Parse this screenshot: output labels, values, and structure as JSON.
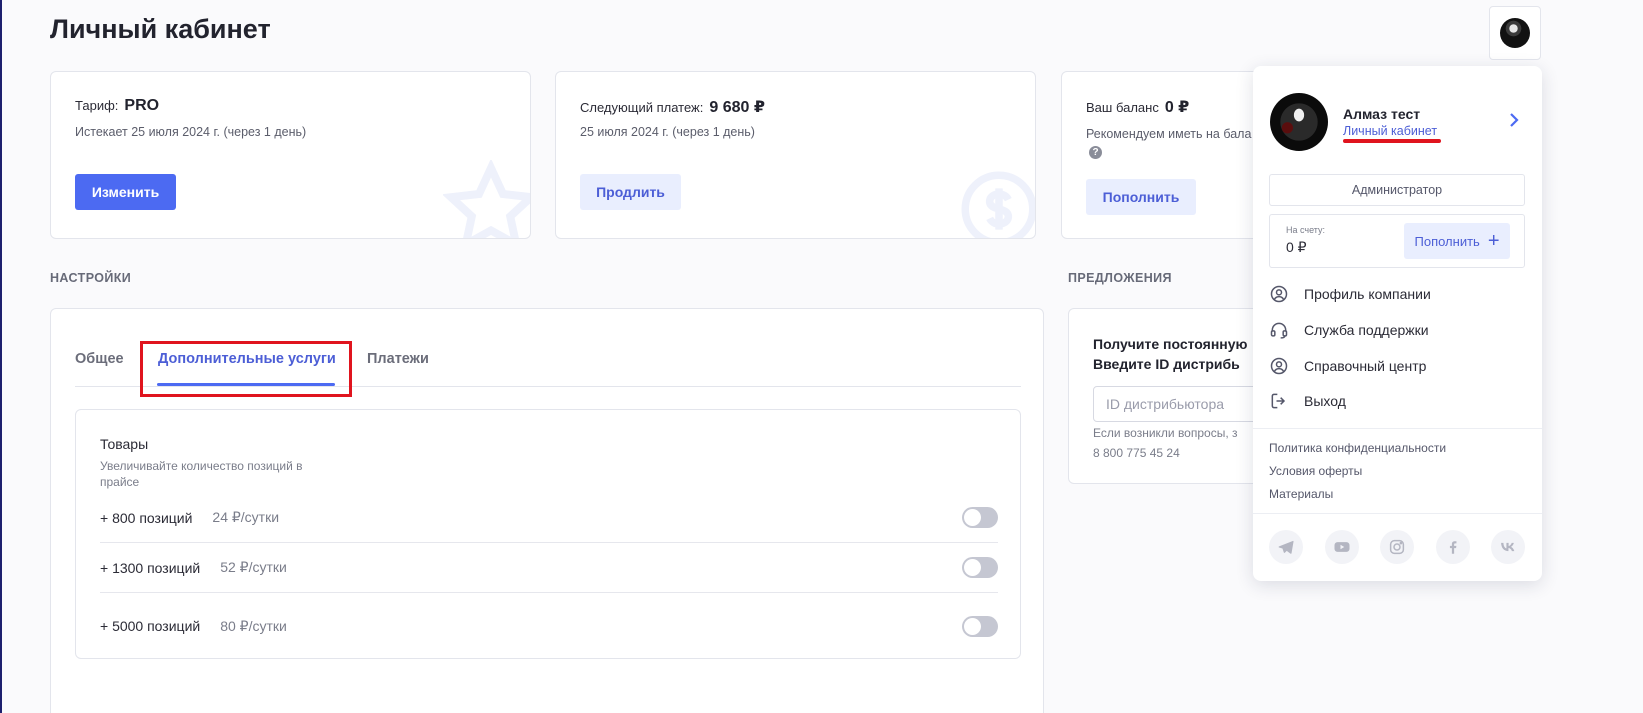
{
  "page": {
    "title": "Личный кабинет"
  },
  "cards": {
    "tariff": {
      "label": "Тариф:",
      "value": "PRO",
      "expires": "Истекает 25 июля 2024 г. (через 1 день)",
      "button": "Изменить"
    },
    "payment": {
      "label": "Следующий платеж:",
      "value": "9 680 ₽",
      "date": "25 июля 2024 г. (через 1 день)",
      "button": "Продлить"
    },
    "balance": {
      "label": "Ваш баланс",
      "value": "0 ₽",
      "recommend": "Рекомендуем иметь на бала",
      "button": "Пополнить"
    }
  },
  "sections": {
    "settings": "НАСТРОЙКИ",
    "offers": "ПРЕДЛОЖЕНИЯ"
  },
  "tabs": [
    {
      "label": "Общее"
    },
    {
      "label": "Дополнительные услуги"
    },
    {
      "label": "Платежи"
    }
  ],
  "goods": {
    "title": "Товары",
    "description": "Увеличивайте количество позиций в  прайсе",
    "options": [
      {
        "name": "+ 800 позиций",
        "price": "24 ₽/сутки",
        "enabled": false
      },
      {
        "name": "+ 1300 позиций",
        "price": "52 ₽/сутки",
        "enabled": false
      },
      {
        "name": "+ 5000 позиций",
        "price": "80 ₽/сутки",
        "enabled": false
      }
    ]
  },
  "offers": {
    "line1": "Получите постоянную",
    "line2": "Введите ID дистрибь",
    "input_placeholder": "ID дистрибьютора",
    "note": "Если возникли вопросы, з",
    "phone": "8 800 775 45 24"
  },
  "dropdown": {
    "user_name": "Алмаз тест",
    "profile_link": "Личный кабинет",
    "role": "Администратор",
    "balance_label": "На счету:",
    "balance_value": "0 ₽",
    "topup": "Пополнить",
    "menu": [
      {
        "label": "Профиль компании",
        "icon": "user-circle-icon"
      },
      {
        "label": "Служба поддержки",
        "icon": "headset-icon"
      },
      {
        "label": "Справочный центр",
        "icon": "user-circle-icon"
      },
      {
        "label": "Выход",
        "icon": "logout-icon"
      }
    ],
    "links": [
      "Политика конфиденциальности",
      "Условия оферты",
      "Материалы"
    ],
    "socials": [
      "telegram-icon",
      "youtube-icon",
      "instagram-icon",
      "facebook-icon",
      "vk-icon"
    ]
  },
  "colors": {
    "accent": "#4c6af2",
    "highlight": "#e0141e"
  }
}
